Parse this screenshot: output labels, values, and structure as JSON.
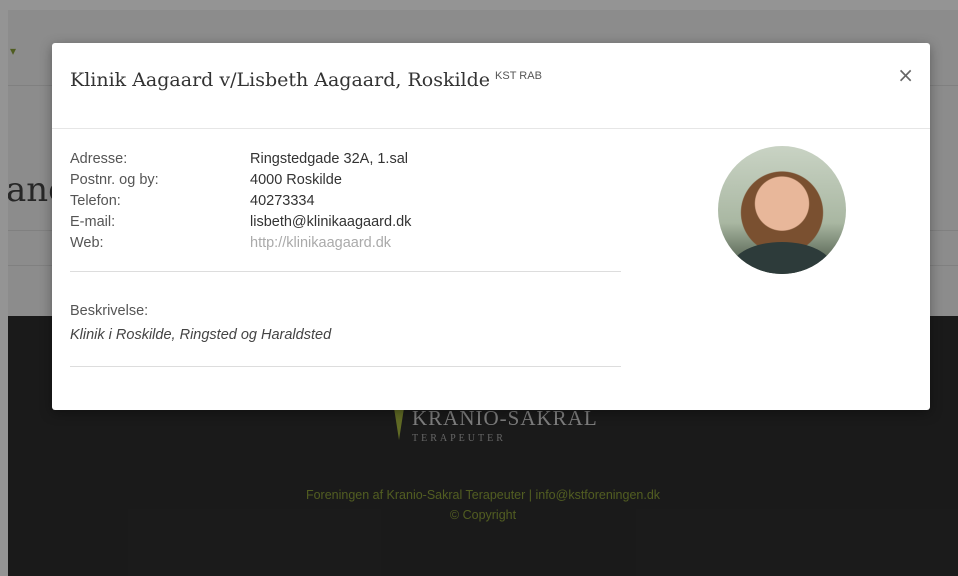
{
  "background": {
    "heading_fragment": "anc",
    "footer": {
      "logo_main": "KRANIO-SAKRAL",
      "logo_sub": "TERAPEUTER",
      "org_line": "Foreningen af Kranio-Sakral Terapeuter | info@kstforeningen.dk",
      "copyright": "© Copyright"
    },
    "accent_color": "#a7b840"
  },
  "modal": {
    "title": "Klinik Aagaard v/Lisbeth Aagaard, Roskilde",
    "tags": "KST RAB",
    "close_label": "×",
    "fields": [
      {
        "label": "Adresse:",
        "value": "Ringstedgade 32A, 1.sal"
      },
      {
        "label": "Postnr. og by:",
        "value": "4000 Roskilde"
      },
      {
        "label": "Telefon:",
        "value": "40273334"
      },
      {
        "label": "E-mail:",
        "value": "lisbeth@klinikaagaard.dk"
      },
      {
        "label": "Web:",
        "value": "http://klinikaagaard.dk"
      }
    ],
    "description_label": "Beskrivelse:",
    "description": "Klinik i Roskilde, Ringsted og Haraldsted",
    "avatar_icon": "profile-photo"
  }
}
